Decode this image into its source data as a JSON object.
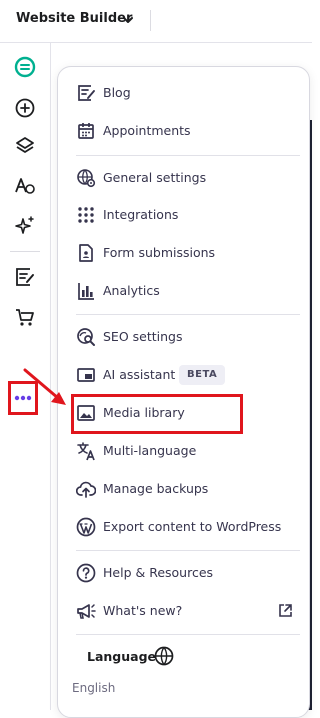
{
  "header": {
    "title": "Website Builder"
  },
  "sidebar": {
    "items": [
      {
        "icon": "checklist-icon",
        "color": "#00b090"
      },
      {
        "icon": "add-icon"
      },
      {
        "icon": "layers-icon"
      },
      {
        "icon": "text-style-icon"
      },
      {
        "icon": "sparkles-icon"
      },
      {
        "icon": "blog-icon"
      },
      {
        "icon": "cart-icon"
      },
      {
        "icon": "more-icon",
        "color": "#673de6"
      }
    ]
  },
  "menu": {
    "items": [
      {
        "label": "Blog",
        "icon": "blog-icon"
      },
      {
        "label": "Appointments",
        "icon": "calendar-icon"
      },
      {
        "label": "General settings",
        "icon": "globe-settings-icon"
      },
      {
        "label": "Integrations",
        "icon": "grid-dots-icon"
      },
      {
        "label": "Form submissions",
        "icon": "form-icon"
      },
      {
        "label": "Analytics",
        "icon": "bar-chart-icon"
      },
      {
        "label": "SEO settings",
        "icon": "seo-search-icon"
      },
      {
        "label": "AI assistant",
        "icon": "ai-assistant-icon",
        "badge": "BETA"
      },
      {
        "label": "Media library",
        "icon": "image-icon"
      },
      {
        "label": "Multi-language",
        "icon": "translate-icon"
      },
      {
        "label": "Manage backups",
        "icon": "cloud-upload-icon"
      },
      {
        "label": "Export content to WordPress",
        "icon": "wordpress-icon"
      },
      {
        "label": "Help & Resources",
        "icon": "help-icon"
      },
      {
        "label": "What's new?",
        "icon": "megaphone-icon",
        "trailing_icon": "external-link-icon"
      }
    ],
    "language": {
      "title": "Language",
      "value": "English"
    }
  },
  "colors": {
    "highlight": "#e0161d",
    "accent": "#673de6",
    "text": "#36344d"
  }
}
